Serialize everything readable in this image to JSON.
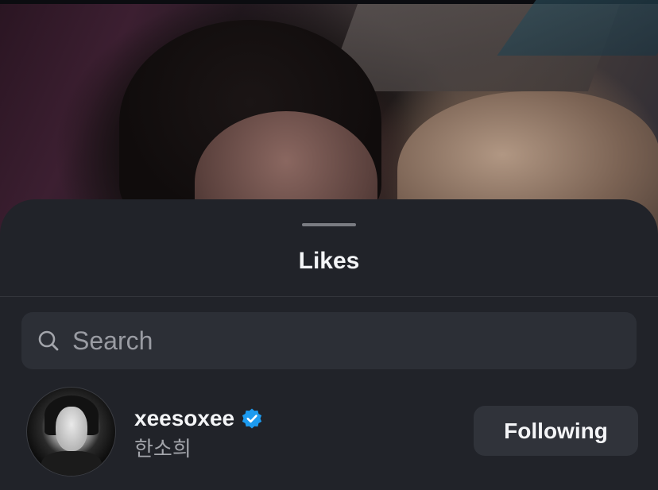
{
  "sheet": {
    "title": "Likes"
  },
  "search": {
    "placeholder": "Search",
    "value": "",
    "icon": "search-icon"
  },
  "likes": [
    {
      "username": "xeesoxee",
      "full_name": "한소희",
      "verified": true,
      "follow_label": "Following"
    }
  ],
  "colors": {
    "sheet_bg": "#212329",
    "search_bg": "#2c2f36",
    "button_bg": "#30333a",
    "verified_blue": "#1d9bf0",
    "secondary_text": "#a3a5ab"
  }
}
